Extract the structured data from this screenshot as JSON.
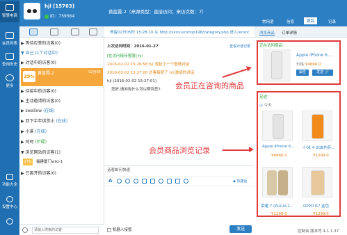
{
  "nav": {
    "items": [
      {
        "label": "智慧电商",
        "icon": "shop-icon"
      },
      {
        "label": "会员列表",
        "icon": "member-list-icon"
      },
      {
        "label": "查询历史",
        "icon": "history-icon"
      },
      {
        "label": "更多",
        "icon": "more-icon"
      }
    ],
    "bottom": [
      {
        "label": "功能大全",
        "icon": "grid-icon"
      },
      {
        "label": "设置中心",
        "icon": "settings-icon"
      },
      {
        "label": "",
        "icon": "power-icon"
      }
    ]
  },
  "user": {
    "name": "hjl [15763]",
    "id": "ID：759564"
  },
  "chat": {
    "title": "黄蓝霞-2（来源类型：直接访问；来访次数：7）",
    "url": "停留02分05秒 15:28:10 从 http://xxxx.ecshop198/category.php  进入/ecshop...",
    "history_link": "查看对话记录",
    "messages": [
      {
        "text": "[在访问接待客服] hjl",
        "color": "green"
      },
      {
        "text": "2016-02-02 15:26:58 hjl 发起了一个邀请对话",
        "color": "orange"
      },
      {
        "text": "2016-02-02 15:27:00 访客接受了 hjl 邀请的对话",
        "color": "orange"
      },
      {
        "text": "hjl (2016-02-02 15:27:01)",
        "color": "normal"
      },
      {
        "text": "您好,请问有什么可以帮到您?",
        "color": "normal"
      }
    ],
    "last_visit_label": "上次访问时间：2016-01-27",
    "quick_reply_label": "话客邮问快速",
    "quick_link": "◆ 快捷话",
    "robot_label": "机器人接管",
    "send_label": "发送"
  },
  "visitors": {
    "rows": [
      {
        "label": "▶ 等待应答的访客(0)"
      },
      {
        "label": "▼ 自己 (1个对话中)",
        "highlight": "b"
      },
      {
        "label": "▶ 对话中的访客(0)"
      }
    ],
    "selected": {
      "pct": "29%",
      "name": "黄蓝霞-2",
      "time": "02分05"
    },
    "rows2": [
      {
        "label": "▶ 待接中的访客(0)"
      },
      {
        "label": "▶ 主动邀请的访客(0)"
      },
      {
        "label": "▶ swallow",
        "status": "(在线)"
      },
      {
        "label": "▶ 双下半年供货小",
        "status": "(在线)"
      },
      {
        "label": "▶ 小溪",
        "status": "(在线)"
      },
      {
        "label": "▶ 阿珂",
        "status": "(忙碌)"
      },
      {
        "label": "▼ 浏览网站的访客(1)"
      }
    ],
    "pct17": {
      "pct": "17%",
      "name": "福建厦门wiki-1"
    },
    "left_row": {
      "label": "▶ 已离开的访客(0)"
    },
    "search_placeholder": "请输入搜索的访客"
  },
  "right": {
    "tabs": [
      "常用语",
      "信息",
      "跟踪",
      "记录"
    ],
    "active_tab": "跟踪",
    "subtabs": [
      "浏览商品",
      "订单详情"
    ],
    "current": {
      "label": "正在访问商品：",
      "name": "Apple iPhone 6...",
      "price_label": "价格",
      "price": "¥4666.0",
      "btn_attr": "属性",
      "btn_link": "发送 🔗"
    },
    "history": {
      "label": "足迹：",
      "day": "今天",
      "items": [
        {
          "name": "Apple iPhone 6...",
          "price": "¥4666.0"
        },
        {
          "name": "小米 4 2GB内存...",
          "price": "¥1299.0"
        },
        {
          "name": "荣耀 7 (PLK-AL1...",
          "price": "¥1299.0"
        },
        {
          "name": "OPPO R7 金色",
          "price": "¥1299.0"
        }
      ]
    },
    "version": "控制台 版本号 4.1.1.37"
  },
  "annotations": {
    "current": "会员正在咨询的商品",
    "history": "会员商品浏览记录"
  },
  "colors": {
    "primary": "#2d7fc4",
    "annotation": "#e03b3b",
    "selected_row": "#f6a73b"
  }
}
